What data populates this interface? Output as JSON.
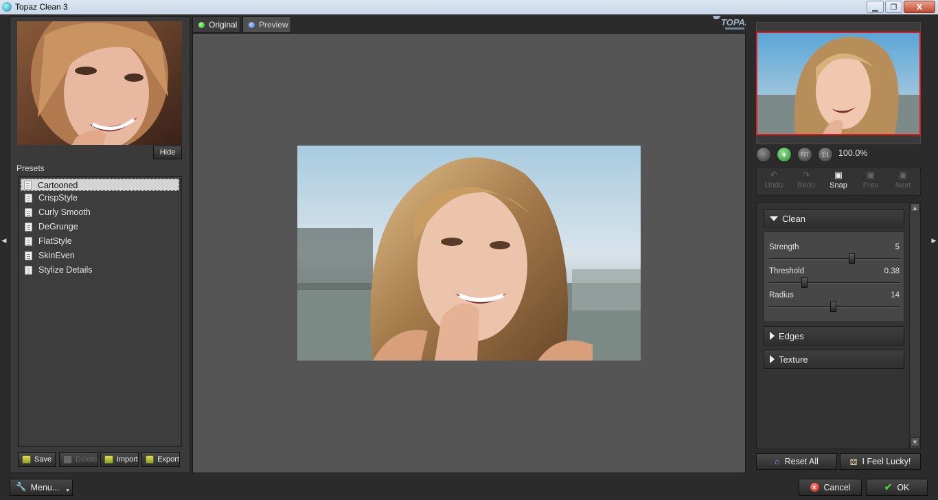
{
  "window": {
    "title": "Topaz Clean 3",
    "minimize_icon": "minimize-icon",
    "maximize_icon": "restore-icon",
    "close_label": "X"
  },
  "left_panel": {
    "hide_label": "Hide",
    "presets_label": "Presets",
    "presets": [
      "Cartooned",
      "CrispStyle",
      "Curly Smooth",
      "DeGrunge",
      "FlatStyle",
      "SkinEven",
      "Stylize Details"
    ],
    "selected_preset": "Cartooned",
    "buttons": {
      "save": "Save",
      "delete": "Delete",
      "import": "Import",
      "export": "Export"
    }
  },
  "tabs": {
    "original": "Original",
    "preview": "Preview",
    "active": "Original"
  },
  "brand": {
    "logo_text": "TOPAZ"
  },
  "navigator": {
    "zoom_level": "100.0%",
    "fit_label": "FIT",
    "one_to_one_label": "1:1"
  },
  "history": {
    "undo": "Undo",
    "redo": "Redo",
    "snap": "Snap",
    "prev": "Prev",
    "next": "Next"
  },
  "adjustments": {
    "clean": {
      "title": "Clean",
      "expanded": true,
      "sliders": [
        {
          "label": "Strength",
          "value": "5",
          "fraction": 0.63
        },
        {
          "label": "Threshold",
          "value": "0.38",
          "fraction": 0.27
        },
        {
          "label": "Radius",
          "value": "14",
          "fraction": 0.49
        }
      ]
    },
    "edges": {
      "title": "Edges",
      "expanded": false
    },
    "texture": {
      "title": "Texture",
      "expanded": false
    }
  },
  "right_buttons": {
    "reset_all": "Reset All",
    "feel_lucky": "I Feel Lucky!"
  },
  "bottom": {
    "menu": "Menu...",
    "cancel": "Cancel",
    "ok": "OK"
  },
  "colors": {
    "selection_border": "#e21a1a",
    "original_dot": "#3ad33a",
    "preview_dot": "#3f6fe0"
  }
}
